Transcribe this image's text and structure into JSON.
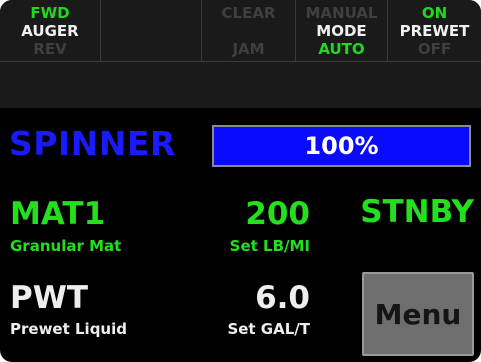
{
  "softkeys": {
    "auger": {
      "top": "FWD",
      "middle": "AUGER",
      "bottom": "REV"
    },
    "clear_jam": {
      "top": "CLEAR",
      "bottom": "JAM"
    },
    "mode": {
      "top": "MANUAL",
      "middle": "MODE",
      "bottom": "AUTO"
    },
    "prewet": {
      "top": "ON",
      "middle": "PREWET",
      "bottom": "OFF"
    }
  },
  "spinner": {
    "label": "SPINNER",
    "value_text": "100%",
    "level_fraction": 1.0
  },
  "material1": {
    "name": "MAT1",
    "description": "Granular Mat",
    "value": "200",
    "unit": "Set LB/MI",
    "status": "STNBY"
  },
  "prewet_row": {
    "name": "PWT",
    "description": "Prewet Liquid",
    "value": "6.0",
    "unit": "Set GAL/T"
  },
  "menu": {
    "label": "Menu"
  },
  "colors": {
    "background": "#000000",
    "active_green": "#22e01c",
    "spinner_blue": "#1a1aff",
    "bar_fill": "#0a0aff",
    "dim_text": "#3f3f3f",
    "menu_button": "#6e6e6e"
  }
}
